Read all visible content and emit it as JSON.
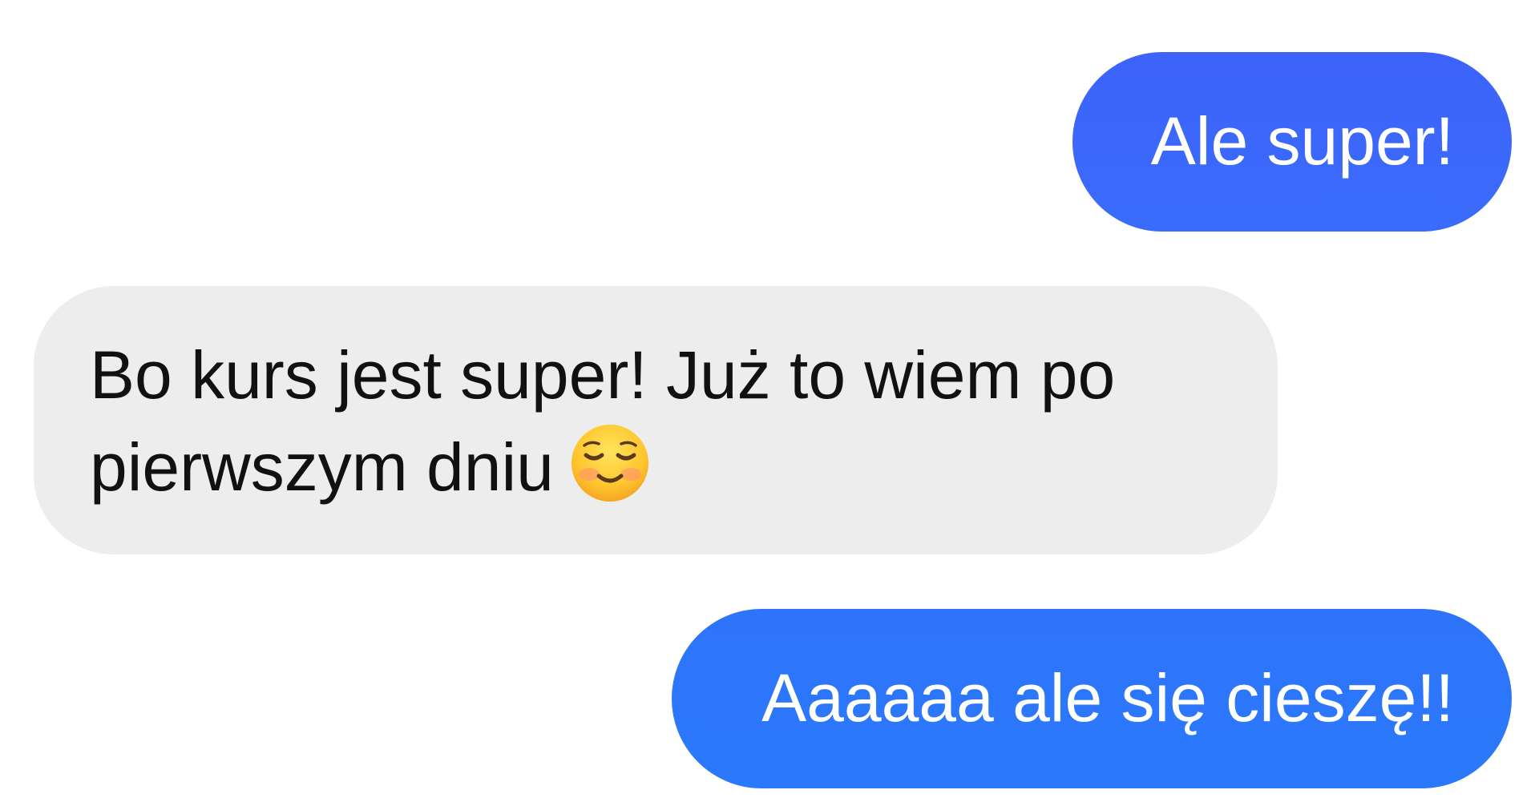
{
  "messages": [
    {
      "direction": "outgoing",
      "text": "Ale super!",
      "color": "#3d66fa"
    },
    {
      "direction": "incoming",
      "line1": "Bo kurs jest super! Już to wiem po",
      "line2": "pierwszym dniu",
      "emoji": "smiling-face-icon",
      "color": "#ededed"
    },
    {
      "direction": "outgoing",
      "text": "Aaaaaa ale się cieszę!!",
      "color": "#2d76fb"
    }
  ]
}
